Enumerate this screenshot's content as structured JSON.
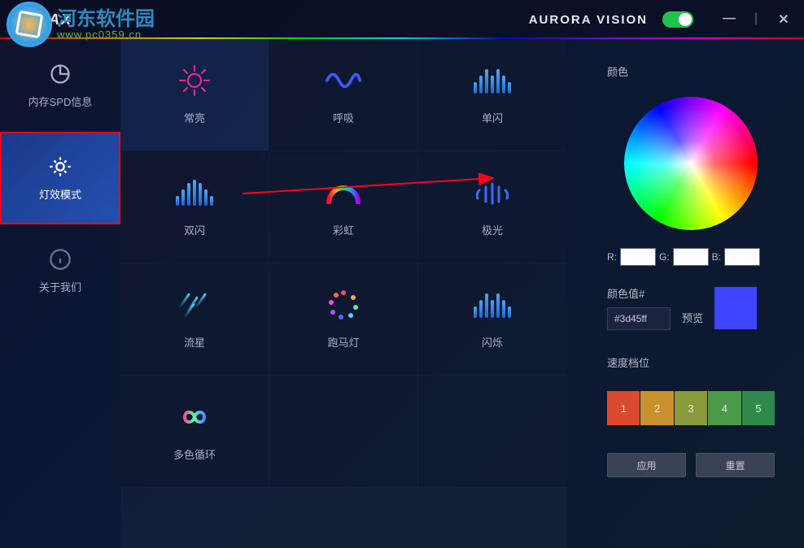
{
  "titlebar": {
    "brand": "GALAX",
    "app_title": "AURORA VISION",
    "minimize": "—",
    "close": "✕"
  },
  "watermark": {
    "cn": "河东软件园",
    "url": "www.pc0359.cn"
  },
  "sidebar": {
    "items": [
      {
        "label": "内存SPD信息"
      },
      {
        "label": "灯效模式"
      },
      {
        "label": "关于我们"
      }
    ]
  },
  "modes": [
    {
      "label": "常亮"
    },
    {
      "label": "呼吸"
    },
    {
      "label": "单闪"
    },
    {
      "label": "双闪"
    },
    {
      "label": "彩虹"
    },
    {
      "label": "极光"
    },
    {
      "label": "流星"
    },
    {
      "label": "跑马灯"
    },
    {
      "label": "闪烁"
    },
    {
      "label": "多色循环"
    }
  ],
  "panel": {
    "color_label": "颜色",
    "r_label": "R:",
    "g_label": "G:",
    "b_label": "B:",
    "r_val": "",
    "g_val": "",
    "b_val": "",
    "hex_label": "颜色值#",
    "hex_val": "#3d45ff",
    "preview_label": "预览",
    "speed_label": "速度档位",
    "speeds": [
      "1",
      "2",
      "3",
      "4",
      "5"
    ],
    "apply": "应用",
    "reset": "重置"
  },
  "chart_data": null
}
